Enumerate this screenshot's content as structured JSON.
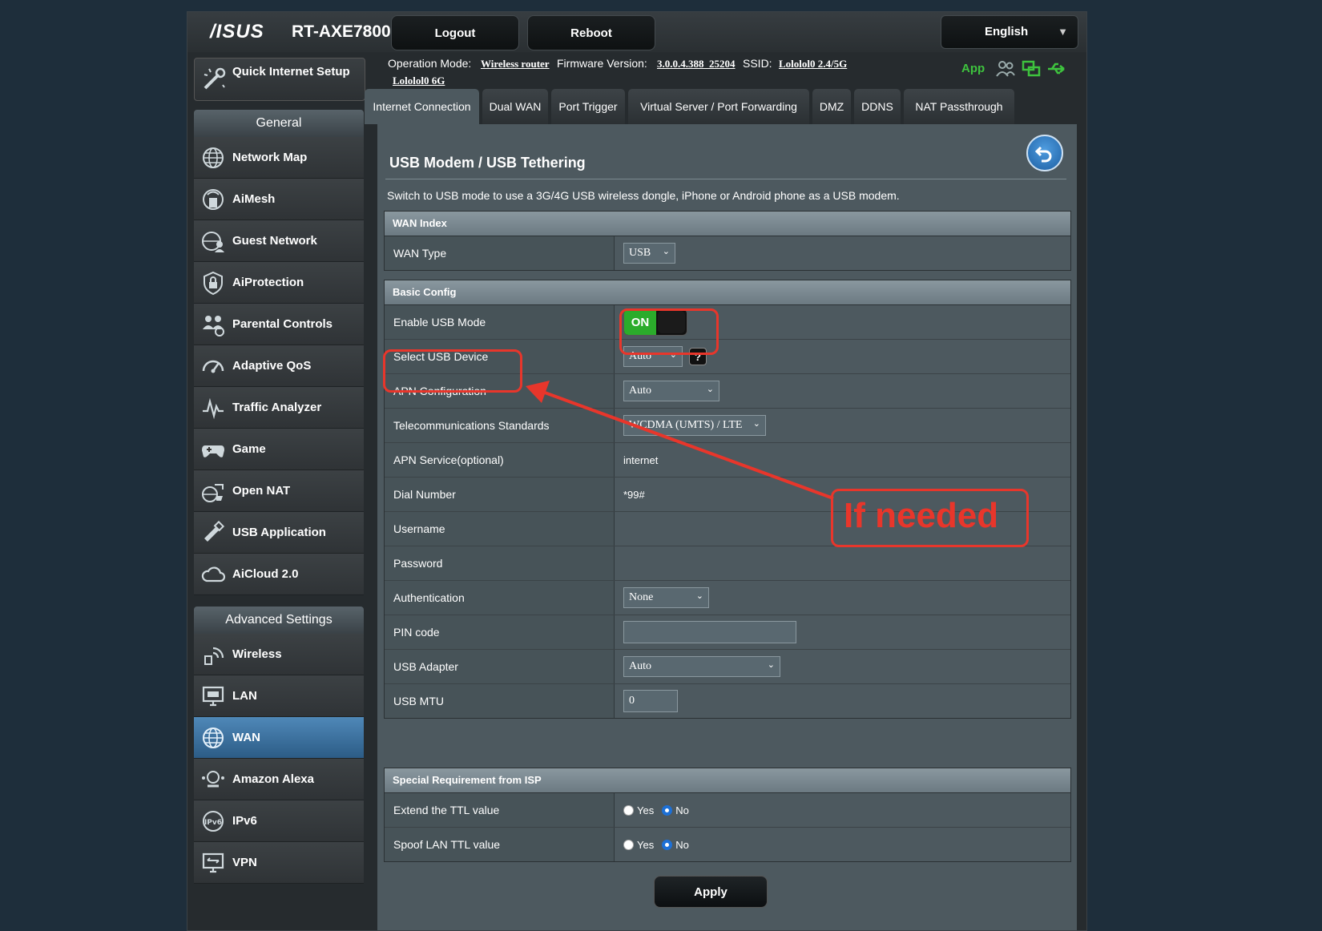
{
  "header": {
    "brand": "/ISUS",
    "model": "RT-AXE7800",
    "logout": "Logout",
    "reboot": "Reboot",
    "language": "English"
  },
  "status": {
    "op_mode_label": "Operation Mode:",
    "op_mode_value": "Wireless router",
    "fw_label": "Firmware Version:",
    "fw_value": "3.0.0.4.388_25204",
    "ssid_label": "SSID:",
    "ssid_value1": "Lololol0 2.4/5G",
    "ssid_value2": "Lololol0 6G",
    "app": "App"
  },
  "sidebar": {
    "quick_setup": "Quick Internet Setup",
    "general_header": "General",
    "general": [
      {
        "label": "Network Map",
        "icon": "globe-network-icon"
      },
      {
        "label": "AiMesh",
        "icon": "aimesh-icon"
      },
      {
        "label": "Guest Network",
        "icon": "guest-network-icon"
      },
      {
        "label": "AiProtection",
        "icon": "shield-lock-icon"
      },
      {
        "label": "Parental Controls",
        "icon": "family-icon"
      },
      {
        "label": "Adaptive QoS",
        "icon": "speedometer-icon"
      },
      {
        "label": "Traffic Analyzer",
        "icon": "traffic-analyzer-icon"
      },
      {
        "label": "Game",
        "icon": "gamepad-icon"
      },
      {
        "label": "Open NAT",
        "icon": "open-nat-icon"
      },
      {
        "label": "USB Application",
        "icon": "usb-stick-icon"
      },
      {
        "label": "AiCloud 2.0",
        "icon": "cloud-icon"
      }
    ],
    "advanced_header": "Advanced Settings",
    "advanced": [
      {
        "label": "Wireless",
        "icon": "wireless-icon"
      },
      {
        "label": "LAN",
        "icon": "lan-monitor-icon"
      },
      {
        "label": "WAN",
        "icon": "wan-globe-icon"
      },
      {
        "label": "Amazon Alexa",
        "icon": "alexa-icon"
      },
      {
        "label": "IPv6",
        "icon": "ipv6-globe-icon"
      },
      {
        "label": "VPN",
        "icon": "vpn-monitor-icon"
      }
    ]
  },
  "tabs": [
    "Internet Connection",
    "Dual WAN",
    "Port Trigger",
    "Virtual Server / Port Forwarding",
    "DMZ",
    "DDNS",
    "NAT Passthrough"
  ],
  "content": {
    "title": "USB Modem / USB Tethering",
    "description": "Switch to USB mode to use a 3G/4G USB wireless dongle, iPhone or Android phone as a USB modem.",
    "wan_index": {
      "header": "WAN Index",
      "wan_type_label": "WAN Type",
      "wan_type_value": "USB"
    },
    "basic": {
      "header": "Basic Config",
      "enable_label": "Enable USB Mode",
      "enable_value": "ON",
      "device_label": "Select USB Device",
      "device_value": "Auto",
      "help": "?",
      "apn_config_label": "APN Configuration",
      "apn_config_value": "Auto",
      "telecom_label": "Telecommunications Standards",
      "telecom_value": "WCDMA (UMTS) / LTE",
      "apn_service_label": "APN Service(optional)",
      "apn_service_value": "internet",
      "dial_label": "Dial Number",
      "dial_value": "*99#",
      "username_label": "Username",
      "password_label": "Password",
      "auth_label": "Authentication",
      "auth_value": "None",
      "pin_label": "PIN code",
      "adapter_label": "USB Adapter",
      "adapter_value": "Auto",
      "mtu_label": "USB MTU",
      "mtu_value": "0"
    },
    "special": {
      "header": "Special Requirement from ISP",
      "ttl_label": "Extend the TTL value",
      "spoof_label": "Spoof LAN TTL value",
      "yes": "Yes",
      "no": "No"
    },
    "apply": "Apply"
  },
  "annotation": {
    "text": "If needed",
    "color": "#e8362b"
  }
}
